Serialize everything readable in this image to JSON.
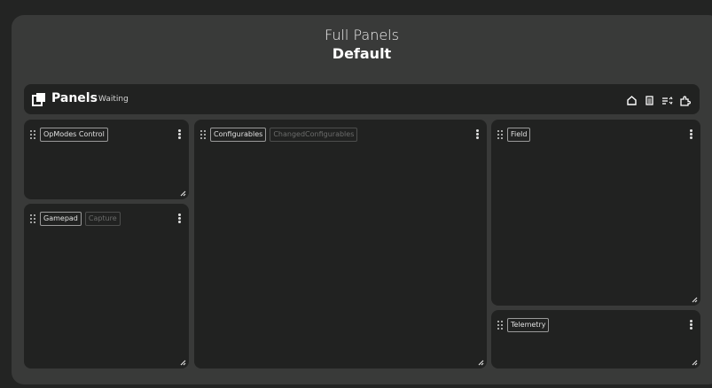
{
  "header": {
    "subtitle": "Full Panels",
    "title": "Default"
  },
  "toolbar": {
    "title": "Panels",
    "status": "Waiting",
    "icons": [
      "home-icon",
      "document-icon",
      "list-sort-icon",
      "plugin-icon"
    ]
  },
  "panels": {
    "opmodes": {
      "tabs": [
        "OpModes Control"
      ]
    },
    "gamepad": {
      "tabs": [
        "Gamepad",
        "Capture"
      ]
    },
    "configurables": {
      "tabs": [
        "Configurables",
        "ChangedConfigurables"
      ]
    },
    "field": {
      "tabs": [
        "Field"
      ]
    },
    "telemetry": {
      "tabs": [
        "Telemetry"
      ]
    }
  }
}
